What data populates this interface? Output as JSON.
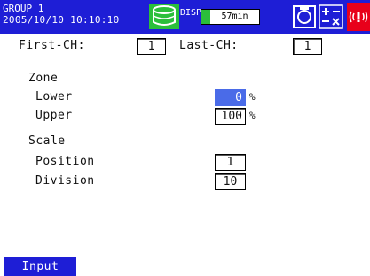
{
  "status_bar": {
    "group_name": "GROUP 1",
    "datetime": "2005/10/10 10:10:10",
    "disp_label": "DISP",
    "disp_value": "57min",
    "icons": [
      "database-icon",
      "memory-card-icon",
      "key-lock-icon",
      "alarm-icon"
    ],
    "colors": {
      "bar": "#1e1ed6",
      "alarm": "#e8001a",
      "disp_fill": "#2bbf3b"
    }
  },
  "channel": {
    "first_label": "First-CH:",
    "first_value": "1",
    "last_label": "Last-CH:",
    "last_value": "1"
  },
  "zone": {
    "heading": "Zone",
    "lower_label": "Lower",
    "lower_value": "0",
    "lower_unit": "%",
    "upper_label": "Upper",
    "upper_value": "100",
    "upper_unit": "%"
  },
  "scale": {
    "heading": "Scale",
    "position_label": "Position",
    "position_value": "1",
    "division_label": "Division",
    "division_value": "10"
  },
  "footer": {
    "input_label": "Input"
  },
  "colors": {
    "selected_field": "#4a6be8"
  }
}
